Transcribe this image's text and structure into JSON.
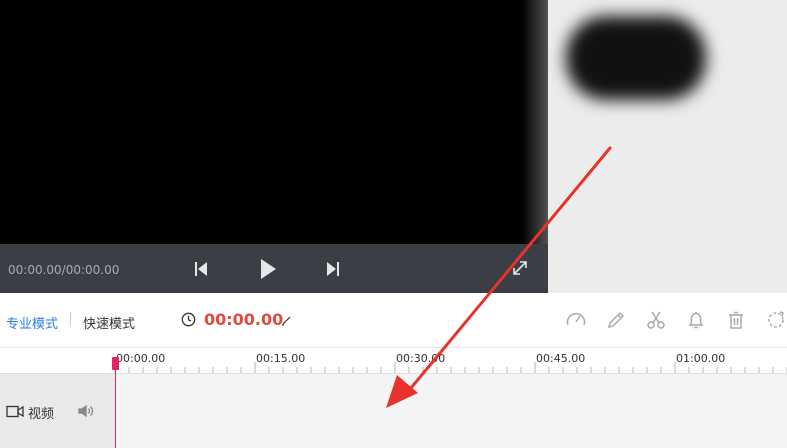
{
  "player": {
    "time_readout": "00:00.00/00:00.00",
    "prev_icon": "skip-back-icon",
    "play_icon": "play-icon",
    "next_icon": "skip-forward-icon",
    "fullscreen_icon": "fullscreen-icon"
  },
  "toolbar": {
    "mode_pro": "专业模式",
    "mode_quick": "快速模式",
    "timecode": "00:00.00",
    "tools": [
      "speed-gauge-icon",
      "pencil-icon",
      "scissors-icon",
      "bell-icon",
      "trash-icon",
      "refresh-icon"
    ]
  },
  "ruler": {
    "labels": [
      "00:00.00",
      "00:15.00",
      "00:30.00",
      "00:45.00",
      "01:00.00"
    ]
  },
  "track": {
    "label": "视频",
    "video_icon": "video-camera-icon",
    "audio_icon": "speaker-icon"
  },
  "colors": {
    "accent": "#2b7ce0",
    "timecode": "#e04b3b",
    "playhead": "#e0245e",
    "annotation_arrow": "#e8322b"
  }
}
